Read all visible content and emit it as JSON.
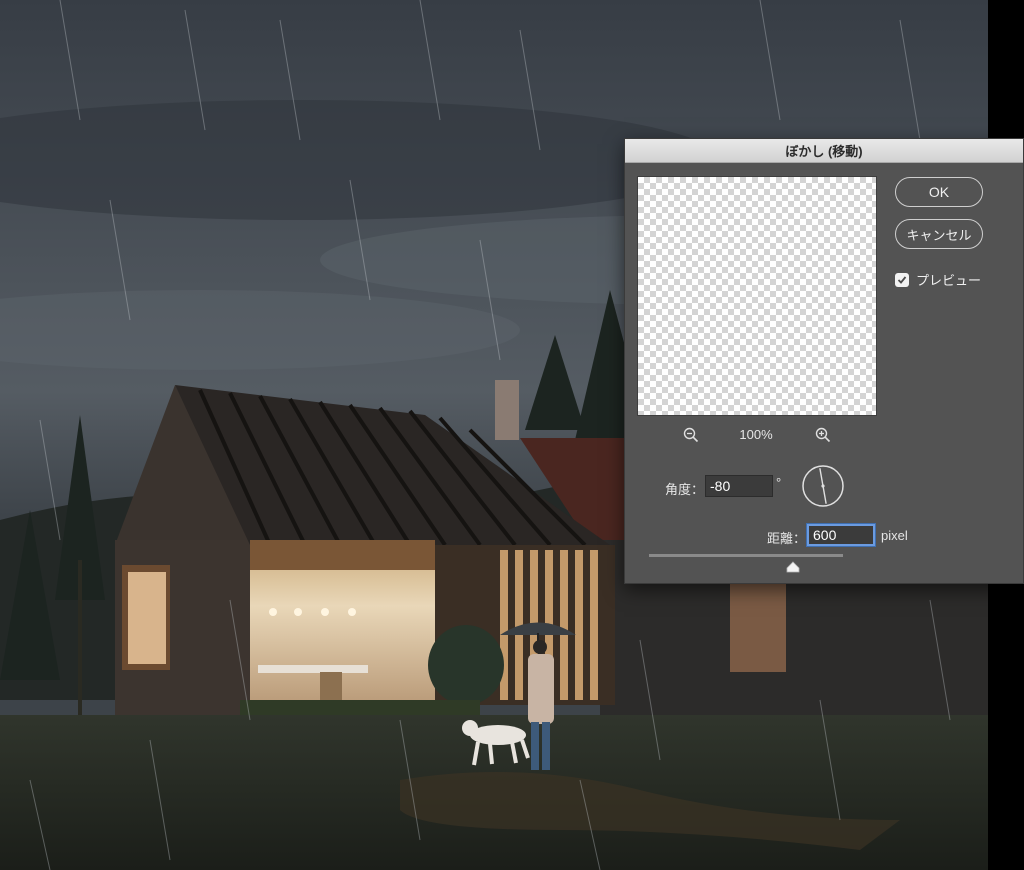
{
  "dialog": {
    "title": "ぼかし (移動)",
    "ok_label": "OK",
    "cancel_label": "キャンセル",
    "preview_label": "プレビュー",
    "preview_checked": true,
    "zoom_level": "100%",
    "angle_label": "角度：",
    "angle_value": "-80",
    "angle_unit": "°",
    "distance_label": "距離：",
    "distance_value": "600",
    "distance_unit": "pixel",
    "distance_slider_fraction": 0.74
  },
  "icons": [
    "zoom-out-icon",
    "zoom-in-icon",
    "checkmark-icon",
    "angle-dial-icon",
    "slider-thumb-icon"
  ]
}
